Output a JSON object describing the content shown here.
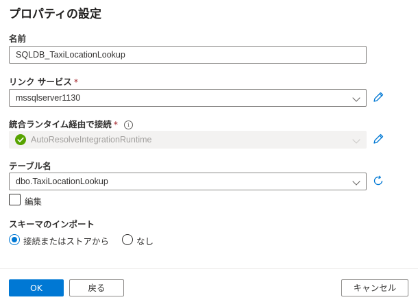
{
  "page": {
    "title": "プロパティの設定"
  },
  "name_field": {
    "label": "名前",
    "value": "SQLDB_TaxiLocationLookup"
  },
  "linked_service": {
    "label": "リンク サービス",
    "required": "*",
    "value": "mssqlserver1130"
  },
  "integration_runtime": {
    "label": "統合ランタイム経由で接続",
    "required": "*",
    "info": "i",
    "value": "AutoResolveIntegrationRuntime"
  },
  "table_name": {
    "label": "テーブル名",
    "value": "dbo.TaxiLocationLookup",
    "edit_label": "編集"
  },
  "schema_import": {
    "label": "スキーマのインポート",
    "options": [
      {
        "label": "接続またはストアから",
        "selected": true
      },
      {
        "label": "なし",
        "selected": false
      }
    ]
  },
  "footer": {
    "ok_label": "OK",
    "back_label": "戻る",
    "cancel_label": "キャンセル"
  },
  "colors": {
    "accent": "#0078d4",
    "success": "#57a300",
    "required": "#a4262c"
  }
}
